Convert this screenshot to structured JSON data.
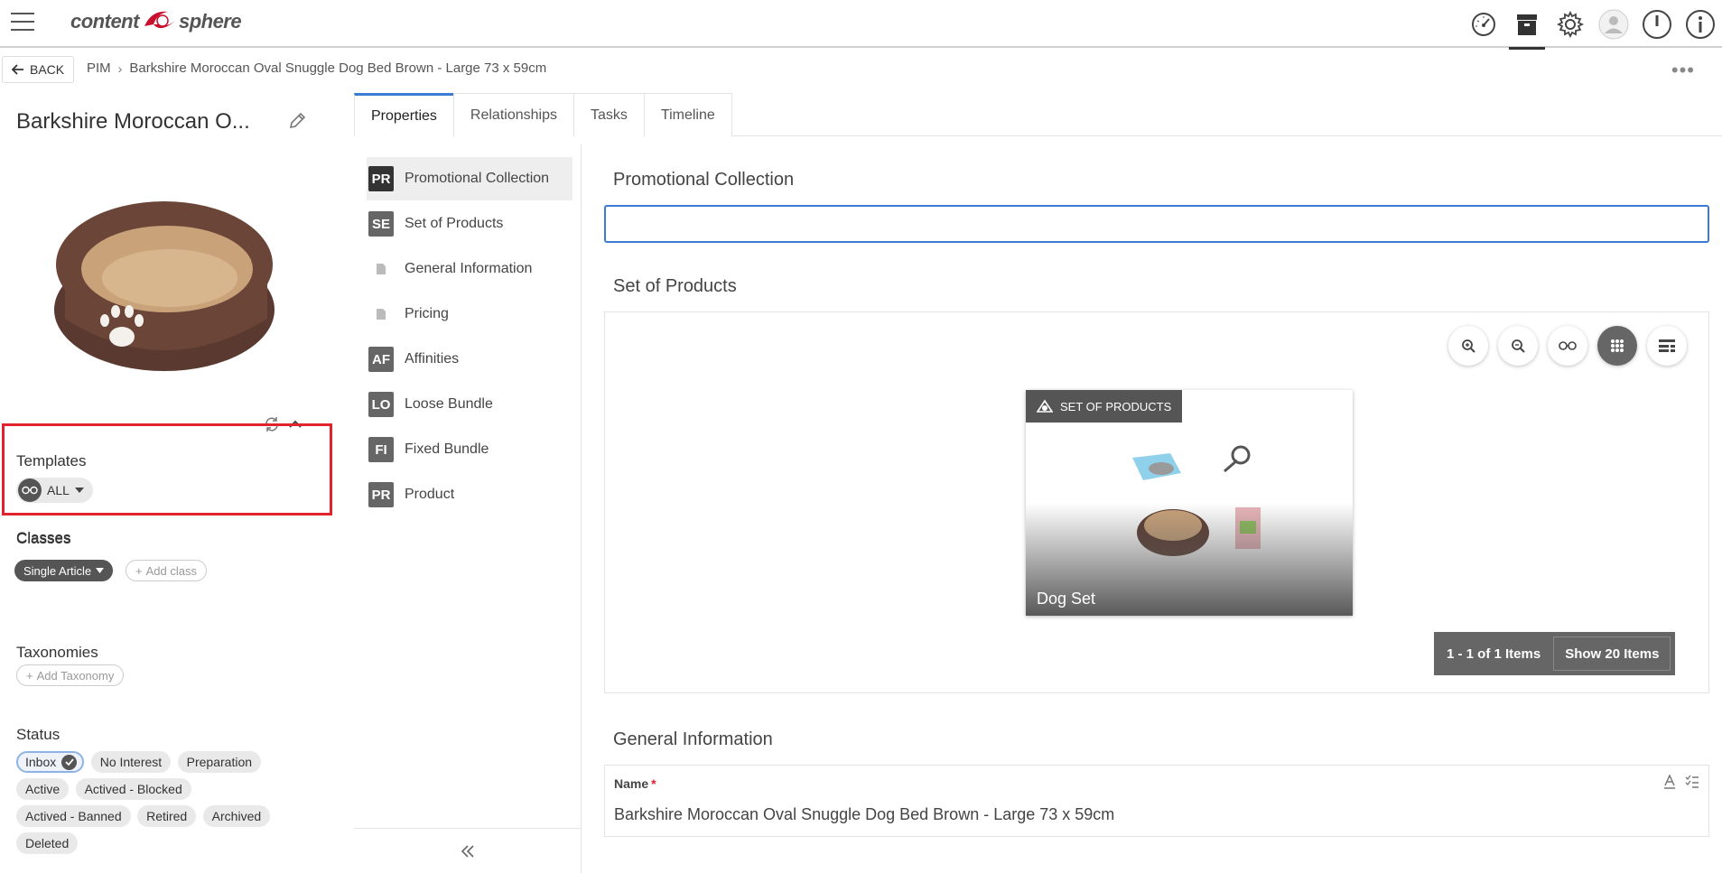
{
  "header": {
    "logo_left": "content",
    "logo_right": "sphere",
    "icons": [
      "dashboard-icon",
      "archive-icon",
      "gear-icon",
      "user-avatar-icon",
      "power-icon",
      "info-icon"
    ]
  },
  "breadcrumb": {
    "back_label": "BACK",
    "items": [
      "PIM",
      "Barkshire Moroccan Oval Snuggle Dog Bed Brown - Large 73 x 59cm"
    ]
  },
  "left": {
    "title": "Barkshire Moroccan O...",
    "templates_label": "Templates",
    "templates_value": "ALL",
    "classes_label": "Classes",
    "class_value": "Single Article",
    "add_class": "Add class",
    "taxonomies_label": "Taxonomies",
    "add_taxonomy": "Add Taxonomy",
    "status_label": "Status",
    "statuses": [
      "Inbox",
      "No Interest",
      "Preparation",
      "Active",
      "Actived - Blocked",
      "Actived - Banned",
      "Retired",
      "Archived",
      "Deleted"
    ],
    "selected_status": "Inbox"
  },
  "tabs": [
    "Properties",
    "Relationships",
    "Tasks",
    "Timeline"
  ],
  "active_tab": "Properties",
  "nav": [
    {
      "badge": "PR",
      "label": "Promotional Collection",
      "active": true
    },
    {
      "badge": "SE",
      "label": "Set of Products"
    },
    {
      "badge": "",
      "label": "General Information"
    },
    {
      "badge": "",
      "label": "Pricing"
    },
    {
      "badge": "AF",
      "label": "Affinities"
    },
    {
      "badge": "LO",
      "label": "Loose Bundle"
    },
    {
      "badge": "FI",
      "label": "Fixed Bundle"
    },
    {
      "badge": "PR",
      "label": "Product"
    }
  ],
  "content": {
    "promo_heading": "Promotional Collection",
    "promo_value": "",
    "set_heading": "Set of Products",
    "card_badge": "SET OF PRODUCTS",
    "card_title": "Dog Set",
    "pager_text": "1 - 1 of 1 Items",
    "pager_button": "Show 20 Items",
    "general_heading": "General Information",
    "name_label": "Name",
    "name_value": "Barkshire Moroccan Oval Snuggle Dog Bed Brown - Large 73 x 59cm"
  },
  "colors": {
    "accent": "#3b7bd4",
    "highlight": "#e0232c",
    "dark_chip": "#555555"
  }
}
